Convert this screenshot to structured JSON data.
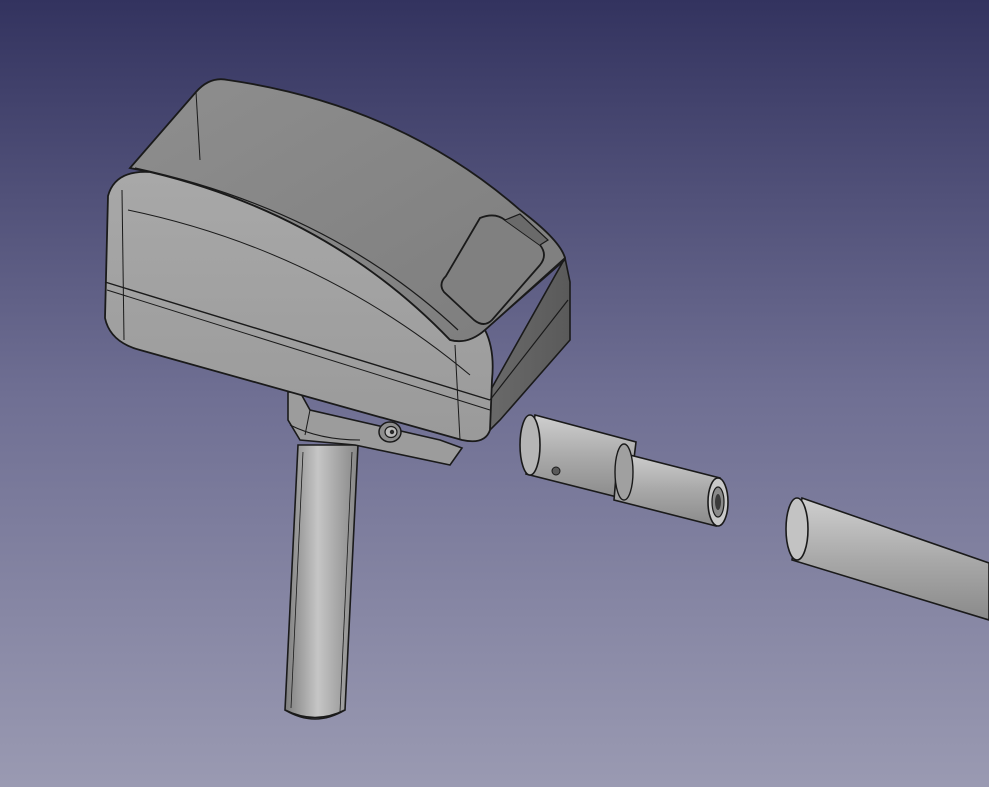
{
  "viewport": {
    "background_top": "#33335f",
    "background_bottom": "#9a9ab2",
    "shading": "flat-lines",
    "edge_color": "#1a1a1a",
    "body_color": "#9b9b9b"
  },
  "scene_parts": [
    {
      "name": "sensor-housing",
      "shape": "rounded-box"
    },
    {
      "name": "display-window",
      "shape": "recessed-panel"
    },
    {
      "name": "mounting-bracket",
      "shape": "block"
    },
    {
      "name": "set-screw",
      "shape": "hex-socket-screw"
    },
    {
      "name": "vertical-rod",
      "shape": "cylinder"
    },
    {
      "name": "stepped-connector",
      "shape": "stepped-cylinder"
    },
    {
      "name": "horizontal-tube",
      "shape": "cylinder"
    }
  ]
}
